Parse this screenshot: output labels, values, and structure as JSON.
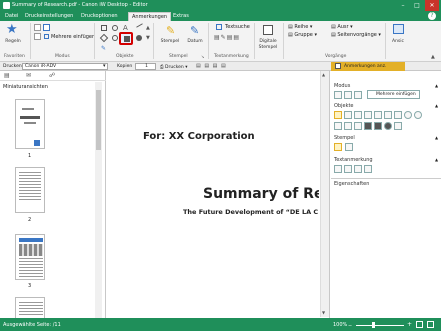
{
  "window": {
    "title": "Summary of Research.pdf - Canon iW Desktop - Editor"
  },
  "tabs": [
    {
      "label": "Datei"
    },
    {
      "label": "Druckeinstellungen"
    },
    {
      "label": "Druckoptionen"
    },
    {
      "label": "Anmerkungen"
    },
    {
      "label": "Extras"
    }
  ],
  "ribbon": {
    "favorites": {
      "button": "Regeln",
      "group": "Favoriten"
    },
    "mode": {
      "multi": "Mehrere einfügen",
      "group": "Modus"
    },
    "objects": {
      "group": "Objekte"
    },
    "stamp": {
      "stamp_label": "Stempel",
      "date_label": "Datum",
      "group": "Stempel"
    },
    "text": {
      "textsuche": "Textsuche",
      "group": "Textanmerkung"
    },
    "digital": {
      "label_line1": "Digitale",
      "label_line2": "Stempel"
    },
    "arrange": {
      "reihe": "Reihe",
      "gruppe": "Gruppe",
      "ausr": "Ausr",
      "seitenvorgaenge": "Seitenvorgänge",
      "group": "Vorgänge"
    },
    "ansicht": {
      "label": "Ansic"
    }
  },
  "toolbar": {
    "drucker_label": "Drucken",
    "printer": "Canon iR-ADV",
    "kopien_label": "Kopien",
    "kopien_value": "1",
    "print_button": "Drucken",
    "annotations_button": "Anmerkungen anz."
  },
  "thumbnails": {
    "title": "Miniaturansichten",
    "pages": [
      "1",
      "2",
      "3"
    ]
  },
  "document": {
    "for_line": "For: XX Corporation",
    "title": "Summary of Rese",
    "subtitle": "The Future Development of “DE LA C"
  },
  "right_panel": {
    "modus": "Modus",
    "multi": "Mehrere einfügen",
    "objekte": "Objekte",
    "stempel": "Stempel",
    "textanmerkung": "Textanmerkung",
    "eigenschaften": "Eigenschaften"
  },
  "status": {
    "left": "Ausgewählte Seite: /11",
    "zoom": "100%"
  },
  "colors": {
    "accent": "#1f8f5a",
    "highlight": "#d40000"
  }
}
